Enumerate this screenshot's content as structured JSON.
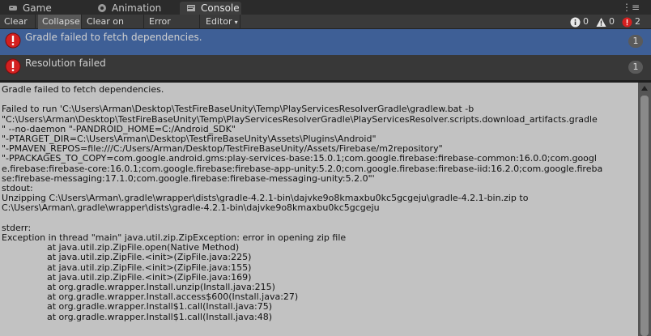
{
  "tabs": [
    {
      "label": "Game",
      "icon": "game-icon"
    },
    {
      "label": "Animation",
      "icon": "animation-icon"
    },
    {
      "label": "Console",
      "icon": "console-icon"
    }
  ],
  "toolbar": {
    "clear": "Clear",
    "collapse": "Collapse",
    "clear_on_play": "Clear on Play",
    "error_pause": "Error Pause",
    "editor": "Editor",
    "info_count": "0",
    "warning_count": "0",
    "error_count": "2"
  },
  "logs": [
    {
      "message": "Gradle failed to fetch dependencies.",
      "count": "1"
    },
    {
      "message": "Resolution failed",
      "count": "1"
    }
  ],
  "detail_text": "Gradle failed to fetch dependencies.\n\nFailed to run 'C:\\Users\\Arman\\Desktop\\TestFireBaseUnity\\Temp\\PlayServicesResolverGradle\\gradlew.bat -b\n\"C:\\Users\\Arman\\Desktop\\TestFireBaseUnity\\Temp\\PlayServicesResolverGradle\\PlayServicesResolver.scripts.download_artifacts.gradle\n\" --no-daemon \"-PANDROID_HOME=C:/Android_SDK\"\n\"-PTARGET_DIR=C:\\Users\\Arman\\Desktop\\TestFireBaseUnity\\Assets\\Plugins\\Android\"\n\"-PMAVEN_REPOS=file:///C:/Users/Arman/Desktop/TestFireBaseUnity/Assets/Firebase/m2repository\"\n\"-PPACKAGES_TO_COPY=com.google.android.gms:play-services-base:15.0.1;com.google.firebase:firebase-common:16.0.0;com.googl\ne.firebase:firebase-core:16.0.1;com.google.firebase:firebase-app-unity:5.2.0;com.google.firebase:firebase-iid:16.2.0;com.google.fireba\nse:firebase-messaging:17.1.0;com.google.firebase:firebase-messaging-unity:5.2.0\"'\nstdout:\nUnzipping C:\\Users\\Arman\\.gradle\\wrapper\\dists\\gradle-4.2.1-bin\\dajvke9o8kmaxbu0kc5gcgeju\\gradle-4.2.1-bin.zip to\nC:\\Users\\Arman\\.gradle\\wrapper\\dists\\gradle-4.2.1-bin\\dajvke9o8kmaxbu0kc5gcgeju\n\nstderr:\nException in thread \"main\" java.util.zip.ZipException: error in opening zip file\n\t\tat java.util.zip.ZipFile.open(Native Method)\n\t\tat java.util.zip.ZipFile.<init>(ZipFile.java:225)\n\t\tat java.util.zip.ZipFile.<init>(ZipFile.java:155)\n\t\tat java.util.zip.ZipFile.<init>(ZipFile.java:169)\n\t\tat org.gradle.wrapper.Install.unzip(Install.java:215)\n\t\tat org.gradle.wrapper.Install.access$600(Install.java:27)\n\t\tat org.gradle.wrapper.Install$1.call(Install.java:75)\n\t\tat org.gradle.wrapper.Install$1.call(Install.java:48)",
  "colors": {
    "selected_row": "#3e5f96",
    "error_red": "#d42020",
    "detail_bg": "#c2c2c2"
  }
}
